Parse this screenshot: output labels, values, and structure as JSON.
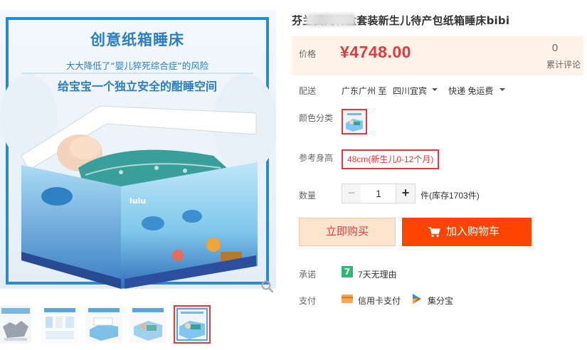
{
  "gallery": {
    "promo_title": "创意纸箱睡床",
    "promo_sub1": "大大降低了“婴儿猝死综合症”的风险",
    "promo_sub2": "给宝宝一个独立安全的酣睡空间",
    "box_brand": "lulu",
    "selected_thumb": 4,
    "icons": {
      "zoom": "zoom-icon"
    }
  },
  "product": {
    "title": "芬兰婴儿礼盒套装新生儿待产包纸箱睡床bibi"
  },
  "price": {
    "label": "价格",
    "value": "¥4748.00",
    "review_count": "0",
    "review_label": "累计评论"
  },
  "delivery": {
    "label": "配送",
    "from": "广东广州 至",
    "to": "四川宜宾",
    "shipping": "快递 免运费"
  },
  "color": {
    "label": "颜色分类"
  },
  "height": {
    "label": "参考身高",
    "option": "48cm(新生儿0-12个月)"
  },
  "quantity": {
    "label": "数量",
    "minus": "−",
    "value": "1",
    "plus": "+",
    "stock": "件(库存1703件)"
  },
  "actions": {
    "buy_now": "立即购买",
    "add_cart": "加入购物车"
  },
  "promise": {
    "label": "承诺",
    "icon_text": "7",
    "text": "7天无理由"
  },
  "payment": {
    "label": "支付",
    "credit": "信用卡支付",
    "jifen": "集分宝"
  },
  "colors": {
    "accent": "#e4393c",
    "cart_button": "#ff4400",
    "buy_button_bg": "#fee3cf",
    "price_bg": "#fff2e8",
    "promo_blue": "#2a7ec4"
  }
}
